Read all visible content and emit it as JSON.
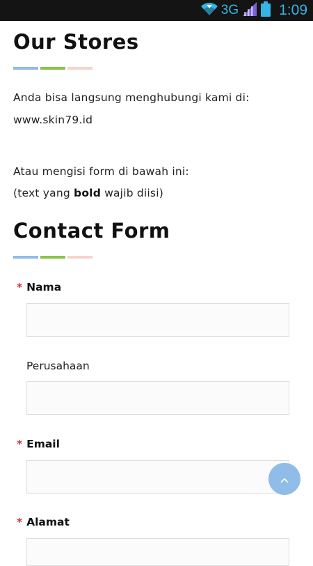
{
  "status_bar": {
    "network": "3G",
    "time": "1:09",
    "icons": [
      "wifi-icon",
      "signal-icon",
      "battery-icon"
    ]
  },
  "stores": {
    "title": "Our Stores",
    "line1": "Anda bisa langsung menghubungi kami di:",
    "website": "www.skin79.id",
    "line2": "Atau mengisi form di bawah ini:",
    "note_before": "(text yang ",
    "note_bold": "bold",
    "note_after": " wajib diisi)"
  },
  "contact_form": {
    "title": "Contact Form",
    "required_marker": "*",
    "fields": {
      "nama": {
        "label": "Nama",
        "value": ""
      },
      "perusahaan": {
        "label": "Perusahaan",
        "value": ""
      },
      "email": {
        "label": "Email",
        "value": ""
      },
      "alamat": {
        "label": "Alamat",
        "value": ""
      }
    }
  },
  "colors": {
    "accent_blue": "#8fbde7",
    "accent_green": "#8bc34a",
    "accent_pink": "#f4d4cc",
    "required": "#d32f2f",
    "statusbar_bg": "#141414",
    "statusbar_fg": "#33b5e5"
  },
  "scroll_top_icon": "chevron-up-icon"
}
